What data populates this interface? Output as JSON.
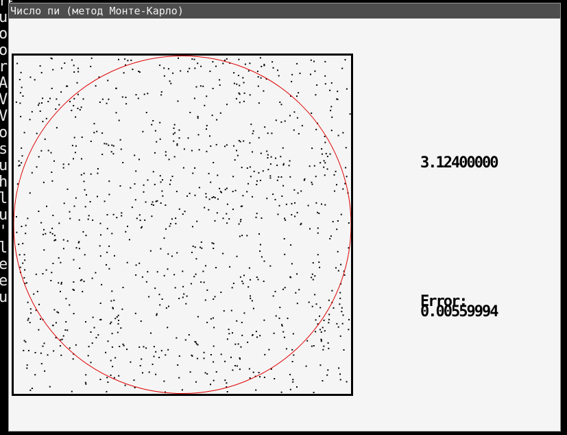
{
  "terminal": {
    "lines": [
      "ren",
      "un",
      "or",
      "or",
      "ro",
      "A",
      "V",
      "V",
      "o",
      "s",
      "u",
      "hi",
      "le",
      "u",
      "'",
      "le",
      "er",
      "er",
      "uf"
    ]
  },
  "window": {
    "title": "Число пи (метод Монте-Карло)"
  },
  "simulation": {
    "pi_estimate": "3.12400000",
    "error_label": "Error:",
    "error_value": "0.00559994",
    "point_count": 1000,
    "points_inside_fraction": 0.781,
    "colors": {
      "circle": "#e00000",
      "points": "#000000",
      "border": "#000000",
      "background": "#f5f5f5"
    }
  }
}
